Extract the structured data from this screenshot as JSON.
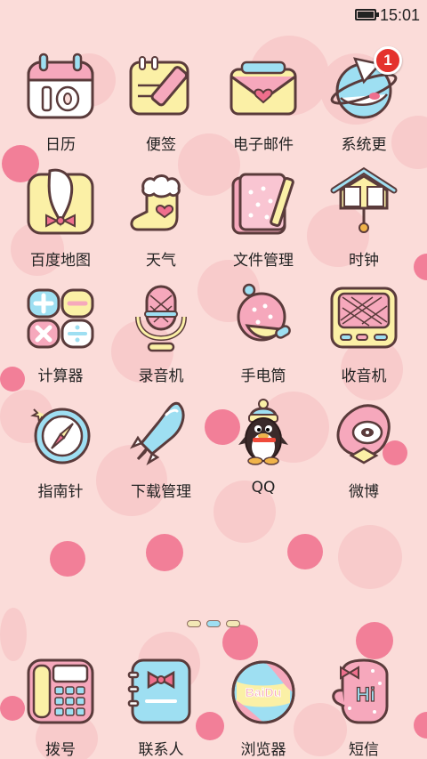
{
  "status_bar": {
    "time": "15:01"
  },
  "apps": [
    {
      "label": "日历",
      "icon": "calendar-icon",
      "calendar_day": "10"
    },
    {
      "label": "便签",
      "icon": "notepad-icon"
    },
    {
      "label": "电子邮件",
      "icon": "mail-icon"
    },
    {
      "label": "系统更",
      "icon": "system-update-icon",
      "badge": "1"
    },
    {
      "label": "百度地图",
      "icon": "map-icon"
    },
    {
      "label": "天气",
      "icon": "weather-boot-icon"
    },
    {
      "label": "文件管理",
      "icon": "folder-icon"
    },
    {
      "label": "时钟",
      "icon": "clock-house-icon"
    },
    {
      "label": "计算器",
      "icon": "calculator-icon"
    },
    {
      "label": "录音机",
      "icon": "microphone-icon"
    },
    {
      "label": "手电筒",
      "icon": "flashlight-icon"
    },
    {
      "label": "收音机",
      "icon": "radio-icon"
    },
    {
      "label": "指南针",
      "icon": "compass-icon"
    },
    {
      "label": "下载管理",
      "icon": "rocket-download-icon"
    },
    {
      "label": "QQ",
      "icon": "qq-penguin-icon"
    },
    {
      "label": "微博",
      "icon": "weibo-icon"
    }
  ],
  "dock": [
    {
      "label": "拨号",
      "icon": "phone-dialer-icon"
    },
    {
      "label": "联系人",
      "icon": "contacts-icon"
    },
    {
      "label": "浏览器",
      "icon": "browser-ball-icon",
      "logo_text": "BaiDu"
    },
    {
      "label": "短信",
      "icon": "message-glove-icon",
      "logo_text": "Hi"
    }
  ],
  "pager": {
    "pages": 3,
    "active": 1
  }
}
